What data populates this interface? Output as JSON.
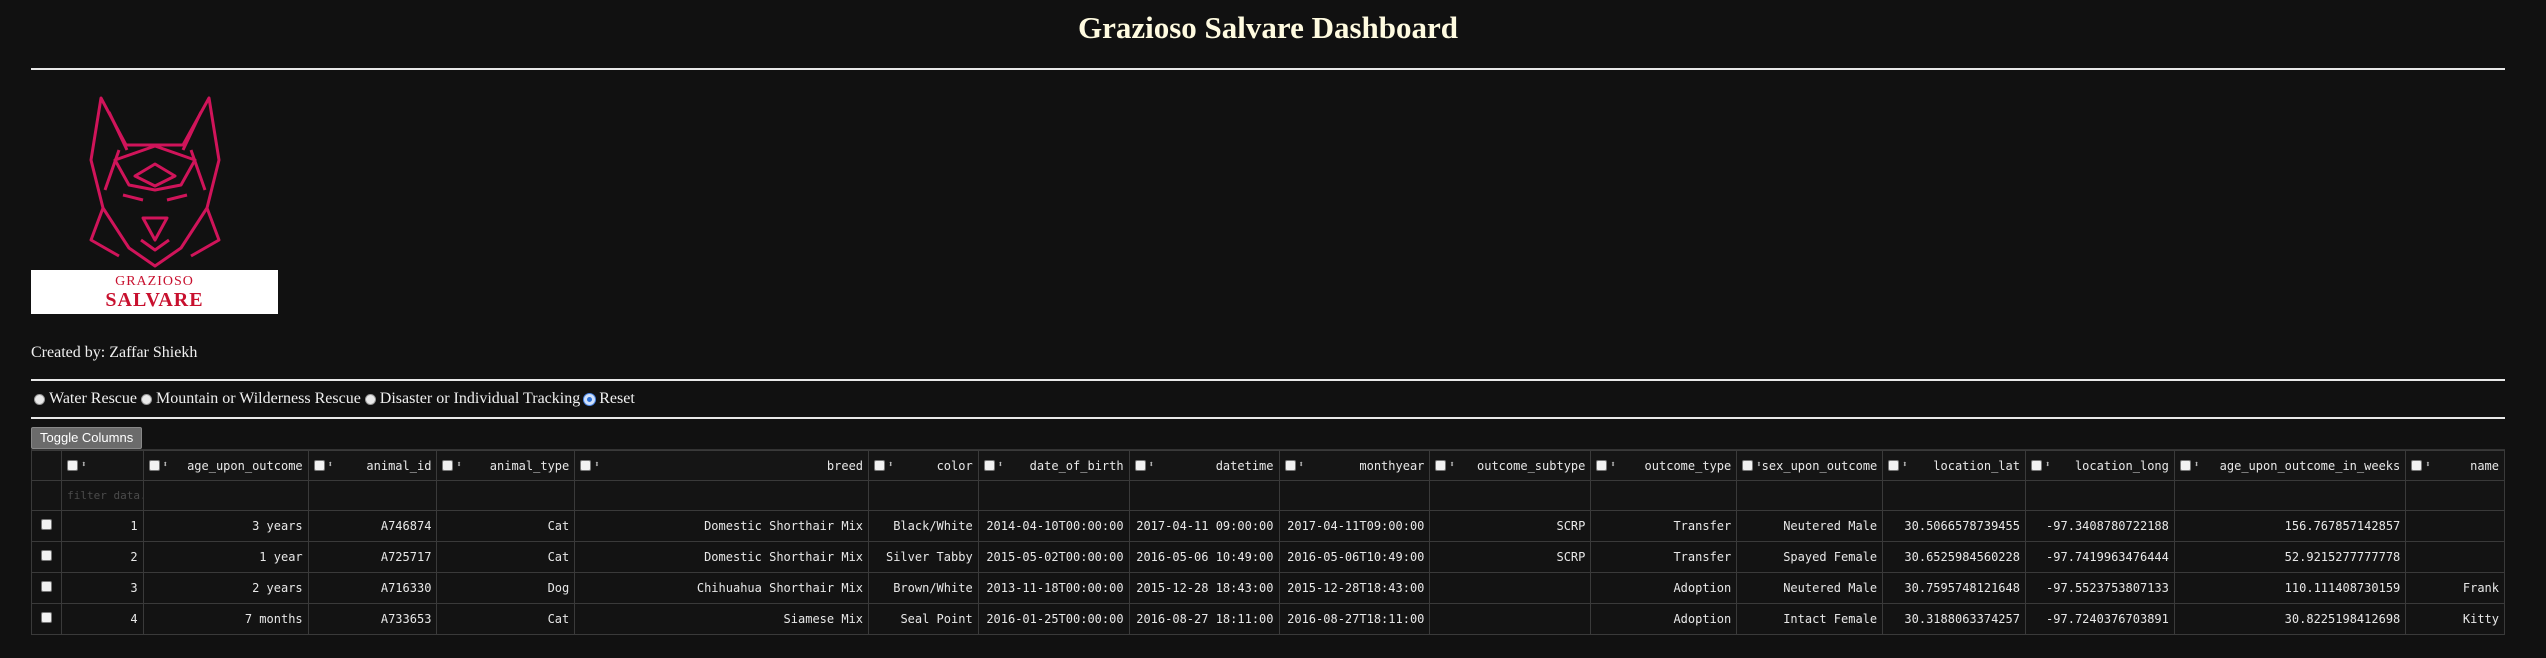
{
  "header": {
    "title": "Grazioso Salvare Dashboard"
  },
  "logo": {
    "line1": "GRAZIOSO",
    "line2": "SALVARE",
    "icon": "dog-head-icon",
    "brand_color": "#c8102e"
  },
  "created_by": "Created by: Zaffar Shiekh",
  "filter_options": [
    {
      "label": "Water Rescue",
      "selected": false
    },
    {
      "label": "Mountain or Wilderness Rescue",
      "selected": false
    },
    {
      "label": "Disaster or Individual Tracking",
      "selected": false
    },
    {
      "label": "Reset",
      "selected": true
    }
  ],
  "toggle_columns_label": "Toggle Columns",
  "table": {
    "filter_placeholder": "filter data...",
    "columns": [
      "age_upon_outcome",
      "animal_id",
      "animal_type",
      "breed",
      "color",
      "date_of_birth",
      "datetime",
      "monthyear",
      "outcome_subtype",
      "outcome_type",
      "sex_upon_outcome",
      "location_lat",
      "location_long",
      "age_upon_outcome_in_weeks",
      "name"
    ],
    "rows": [
      [
        "1",
        "3 years",
        "A746874",
        "Cat",
        "Domestic Shorthair Mix",
        "Black/White",
        "2014-04-10T00:00:00",
        "2017-04-11 09:00:00",
        "2017-04-11T09:00:00",
        "SCRP",
        "Transfer",
        "Neutered Male",
        "30.5066578739455",
        "-97.3408780722188",
        "156.767857142857",
        ""
      ],
      [
        "2",
        "1 year",
        "A725717",
        "Cat",
        "Domestic Shorthair Mix",
        "Silver Tabby",
        "2015-05-02T00:00:00",
        "2016-05-06 10:49:00",
        "2016-05-06T10:49:00",
        "SCRP",
        "Transfer",
        "Spayed Female",
        "30.6525984560228",
        "-97.7419963476444",
        "52.9215277777778",
        ""
      ],
      [
        "3",
        "2 years",
        "A716330",
        "Dog",
        "Chihuahua Shorthair Mix",
        "Brown/White",
        "2013-11-18T00:00:00",
        "2015-12-28 18:43:00",
        "2015-12-28T18:43:00",
        "",
        "Adoption",
        "Neutered Male",
        "30.7595748121648",
        "-97.5523753807133",
        "110.111408730159",
        "Frank"
      ],
      [
        "4",
        "7 months",
        "A733653",
        "Cat",
        "Siamese Mix",
        "Seal Point",
        "2016-01-25T00:00:00",
        "2016-08-27 18:11:00",
        "2016-08-27T18:11:00",
        "",
        "Adoption",
        "Intact Female",
        "30.3188063374257",
        "-97.7240376703891",
        "30.8225198412698",
        "Kitty"
      ]
    ]
  }
}
